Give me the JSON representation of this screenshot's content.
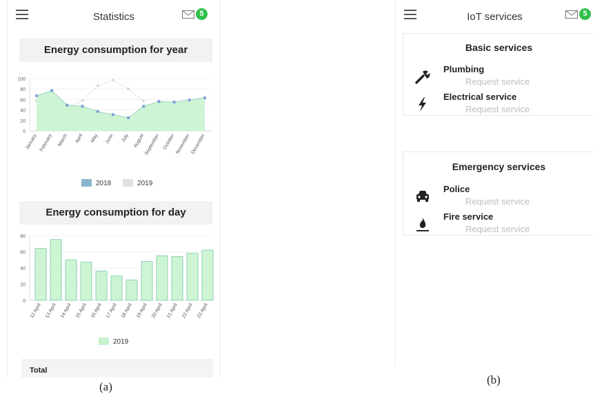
{
  "left_screen": {
    "header": {
      "title": "Statistics",
      "mail_badge": "5"
    },
    "year_chart": {
      "heading": "Energy consumption for year"
    },
    "day_chart": {
      "heading": "Energy consumption for day"
    },
    "total_label": "Total",
    "caption": "(a)"
  },
  "right_screen": {
    "header": {
      "title": "IoT services",
      "mail_badge": "5"
    },
    "basic": {
      "heading": "Basic services",
      "items": [
        {
          "name": "Plumbing",
          "action": "Request service",
          "icon": "wrench-icon"
        },
        {
          "name": "Electrical service",
          "action": "Request service",
          "icon": "lightning-icon"
        }
      ]
    },
    "emergency": {
      "heading": "Emergency services",
      "items": [
        {
          "name": "Police",
          "action": "Request service",
          "icon": "police-car-icon"
        },
        {
          "name": "Fire service",
          "action": "Request service",
          "icon": "fire-icon"
        }
      ]
    },
    "caption": "(b)"
  },
  "colors": {
    "accent_green": "#2fc04a",
    "series_2018": "#8ab6cf",
    "series_2019": "#cfcfcf",
    "area_fill": "#c8f3cf",
    "bar_fill": "#cdf5d4",
    "bar_stroke": "#8ccfb3"
  },
  "chart_data": [
    {
      "type": "area",
      "categories": [
        "January",
        "February",
        "March",
        "April",
        "May",
        "June",
        "July",
        "August",
        "September",
        "October",
        "November",
        "December"
      ],
      "series": [
        {
          "name": "2018",
          "values": [
            67,
            77,
            49,
            47,
            37,
            31,
            25,
            47,
            56,
            55,
            59,
            63
          ]
        },
        {
          "name": "2019",
          "values": [
            57,
            48,
            42,
            58,
            86,
            97,
            80,
            57,
            0,
            0,
            0,
            0
          ]
        }
      ],
      "yticks": [
        0,
        20,
        40,
        60,
        80,
        100
      ],
      "ylim": [
        0,
        100
      ],
      "legend": "bottom"
    },
    {
      "type": "bar",
      "categories": [
        "12 April",
        "13 April",
        "14 April",
        "15 April",
        "16 April",
        "17 April",
        "18 April",
        "19 April",
        "20 April",
        "21 April",
        "22 April",
        "23 April"
      ],
      "series": [
        {
          "name": "2019",
          "values": [
            64,
            75,
            50,
            47,
            36,
            30,
            25,
            48,
            55,
            54,
            58,
            62
          ]
        }
      ],
      "yticks": [
        0,
        20,
        40,
        60,
        80
      ],
      "ylim": [
        0,
        80
      ],
      "legend": "bottom"
    }
  ]
}
